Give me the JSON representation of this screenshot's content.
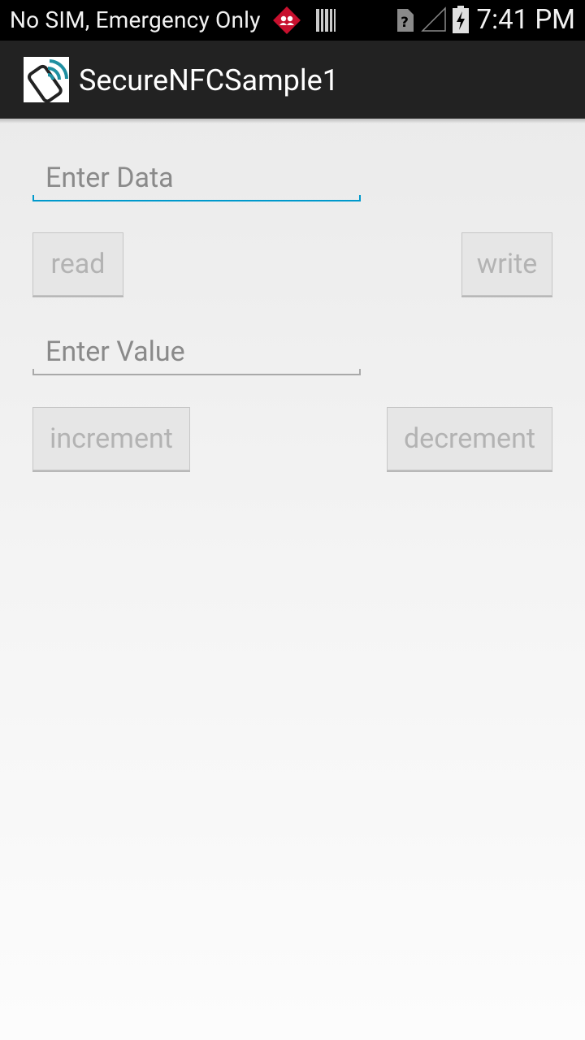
{
  "status_bar": {
    "carrier_text": "No SIM, Emergency Only",
    "time": "7:41 PM",
    "icons": [
      "alert-diamond-icon",
      "barcode-icon",
      "unknown-sim-icon",
      "signal-empty-icon",
      "battery-charging-icon"
    ]
  },
  "app_bar": {
    "title": "SecureNFCSample1",
    "icon": "nfc-phone-icon"
  },
  "form": {
    "data_field": {
      "placeholder": "Enter Data",
      "value": ""
    },
    "read_label": "read",
    "write_label": "write",
    "value_field": {
      "placeholder": "Enter Value",
      "value": ""
    },
    "increment_label": "increment",
    "decrement_label": "decrement"
  },
  "colors": {
    "accent": "#0099cc",
    "app_bar": "#222222",
    "button_bg": "#e6e6e6",
    "button_text_disabled": "#b3b3b3"
  }
}
